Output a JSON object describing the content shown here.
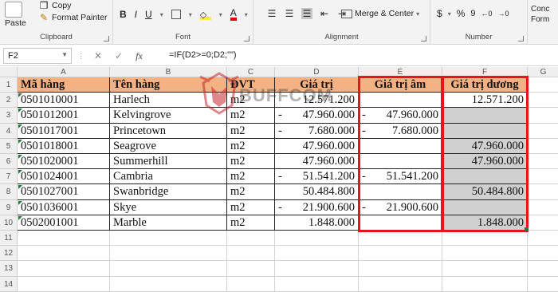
{
  "ribbon": {
    "paste_label": "Paste",
    "copy_label": "Copy",
    "format_painter_label": "Format Painter",
    "clipboard_label": "Clipboard",
    "font_label": "Font",
    "alignment_label": "Alignment",
    "number_label": "Number",
    "merge_center_label": "Merge & Center",
    "bold": "B",
    "italic": "I",
    "underline": "U",
    "font_color_letter": "A",
    "currency_symbol": "$",
    "percent_symbol": "%",
    "comma_symbol": "9",
    "cond_label": "Conc",
    "form_label": "Form"
  },
  "formula_bar": {
    "name_box": "F2",
    "formula": "=IF(D2>=0;D2;\"\")"
  },
  "columns": [
    "A",
    "B",
    "C",
    "D",
    "E",
    "F",
    "G"
  ],
  "rows": [
    "1",
    "2",
    "3",
    "4",
    "5",
    "6",
    "7",
    "8",
    "9",
    "10",
    "11",
    "12",
    "13",
    "14"
  ],
  "table": {
    "headers": [
      "Mã hàng",
      "Tên hàng",
      "ĐVT",
      "Giá trị",
      "Giá trị âm",
      "Giá trị dương"
    ],
    "data": [
      {
        "code": "0501010001",
        "name": "Harlech",
        "unit": "m2",
        "value": "12.571.200",
        "negative": "",
        "positive": "12.571.200"
      },
      {
        "code": "0501012001",
        "name": "Kelvingrove",
        "unit": "m2",
        "value": "47.960.000",
        "negative": "47.960.000",
        "positive": ""
      },
      {
        "code": "0501017001",
        "name": "Princetown",
        "unit": "m2",
        "value": "7.680.000",
        "negative": "7.680.000",
        "positive": ""
      },
      {
        "code": "0501018001",
        "name": "Seagrove",
        "unit": "m2",
        "value": "47.960.000",
        "negative": "",
        "positive": "47.960.000"
      },
      {
        "code": "0501020001",
        "name": "Summerhill",
        "unit": "m2",
        "value": "47.960.000",
        "negative": "",
        "positive": "47.960.000"
      },
      {
        "code": "0501024001",
        "name": "Cambria",
        "unit": "m2",
        "value": "51.541.200",
        "negative": "51.541.200",
        "positive": ""
      },
      {
        "code": "0501027001",
        "name": "Swanbridge",
        "unit": "m2",
        "value": "50.484.800",
        "negative": "",
        "positive": "50.484.800"
      },
      {
        "code": "0501036001",
        "name": "Skye",
        "unit": "m2",
        "value": "21.900.600",
        "negative": "21.900.600",
        "positive": ""
      },
      {
        "code": "0502001001",
        "name": "Marble",
        "unit": "m2",
        "value": "1.848.000",
        "negative": "",
        "positive": "1.848.000"
      }
    ],
    "value_is_negative": [
      false,
      true,
      true,
      false,
      false,
      true,
      false,
      true,
      false
    ],
    "minus_sign": "-"
  },
  "watermark": "BUFFCOM",
  "colors": {
    "header_fill": "#f4b183",
    "highlight_outline": "#e8141b",
    "grey_fill": "#d0d0d0"
  }
}
